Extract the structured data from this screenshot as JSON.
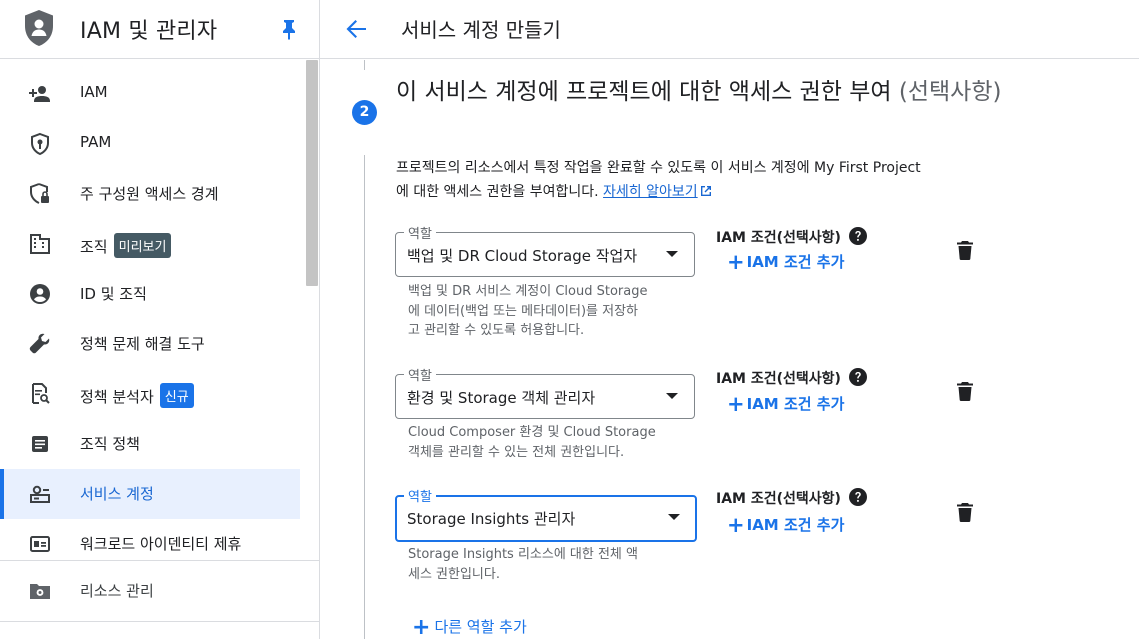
{
  "sidebar": {
    "title": "IAM 및 관리자",
    "items": [
      {
        "label": "IAM",
        "icon": "person-add-icon",
        "badge": ""
      },
      {
        "label": "PAM",
        "icon": "shield-key-icon",
        "badge": ""
      },
      {
        "label": "주 구성원 액세스 경계",
        "icon": "shield-lock-icon",
        "badge": ""
      },
      {
        "label": "조직",
        "icon": "building-icon",
        "badge": "미리보기"
      },
      {
        "label": "ID 및 조직",
        "icon": "account-circle-icon",
        "badge": ""
      },
      {
        "label": "정책 문제 해결 도구",
        "icon": "wrench-icon",
        "badge": ""
      },
      {
        "label": "정책 분석자",
        "icon": "doc-search-icon",
        "badge": "신규"
      },
      {
        "label": "조직 정책",
        "icon": "list-doc-icon",
        "badge": ""
      },
      {
        "label": "서비스 계정",
        "icon": "service-account-icon",
        "badge": ""
      },
      {
        "label": "워크로드 아이덴티티 제휴",
        "icon": "id-card-icon",
        "badge": ""
      }
    ],
    "bottom_item": "리소스 관리",
    "active_item": "서비스 계정"
  },
  "header": {
    "page_title": "서비스 계정 만들기"
  },
  "step": {
    "number": "2",
    "heading": "이 서비스 계정에 프로젝트에 대한 액세스 권한 부여 ",
    "heading_optional": "(선택사항)",
    "desc_line1": "프로젝트의 리소스에서 특정 작업을 완료할 수 있도록 이 서비스 계정에 My First Project",
    "desc_line2": "에 대한 액세스 권한을 부여합니다.",
    "learn_more": "자세히 알아보기"
  },
  "roles": [
    {
      "field_label": "역할",
      "value": "백업 및 DR Cloud Storage 작업자",
      "help": "백업 및 DR 서비스 계정이 Cloud Storage 에 데이터(백업 또는 메타데이터)를 저장하고 관리할 수 있도록 허용합니다.",
      "help_lines": [
        "백업 및 DR 서비스 계정이 Cloud Storage",
        "에 데이터(백업 또는 메타데이터)를 저장하",
        "고 관리할 수 있도록 허용합니다."
      ],
      "condition_title": "IAM 조건(선택사항)",
      "add_condition": "IAM 조건 추가"
    },
    {
      "field_label": "역할",
      "value": "환경 및 Storage 객체 관리자",
      "help_lines": [
        "Cloud Composer 환경 및 Cloud Storage",
        "객체를 관리할 수 있는 전체 권한입니다."
      ],
      "condition_title": "IAM 조건(선택사항)",
      "add_condition": "IAM 조건 추가"
    },
    {
      "field_label": "역할",
      "value": "Storage Insights 관리자",
      "help_lines": [
        "Storage Insights 리소스에 대한 전체 액",
        "세스 권한입니다."
      ],
      "condition_title": "IAM 조건(선택사항)",
      "add_condition": "IAM 조건 추가"
    }
  ],
  "add_role": "다른 역할 추가",
  "colors": {
    "accent": "#1a73e8",
    "active_bg": "#e8f0fe",
    "badge_dark": "#455a64",
    "badge_new": "#1a73e8"
  }
}
